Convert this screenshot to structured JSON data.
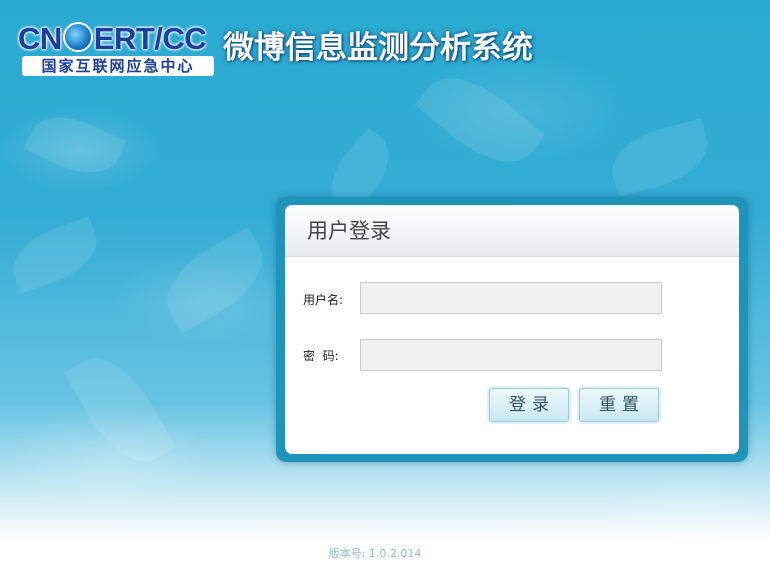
{
  "header": {
    "logo_main_left": "CN",
    "logo_main_right": "ERT/CC",
    "logo_sub": "国家互联网应急中心",
    "system_title": "微博信息监测分析系统"
  },
  "login": {
    "title": "用户登录",
    "username_label": "用户名:",
    "username_value": "",
    "password_label": "密  码:",
    "password_value": "",
    "login_button": "登录",
    "reset_button": "重置"
  },
  "footer": {
    "version_text": "版本号: 1.0.2.014"
  },
  "colors": {
    "background": "#2aaad2",
    "panel_border": "#1e94bb",
    "logo_blue": "#1c3f9c"
  }
}
